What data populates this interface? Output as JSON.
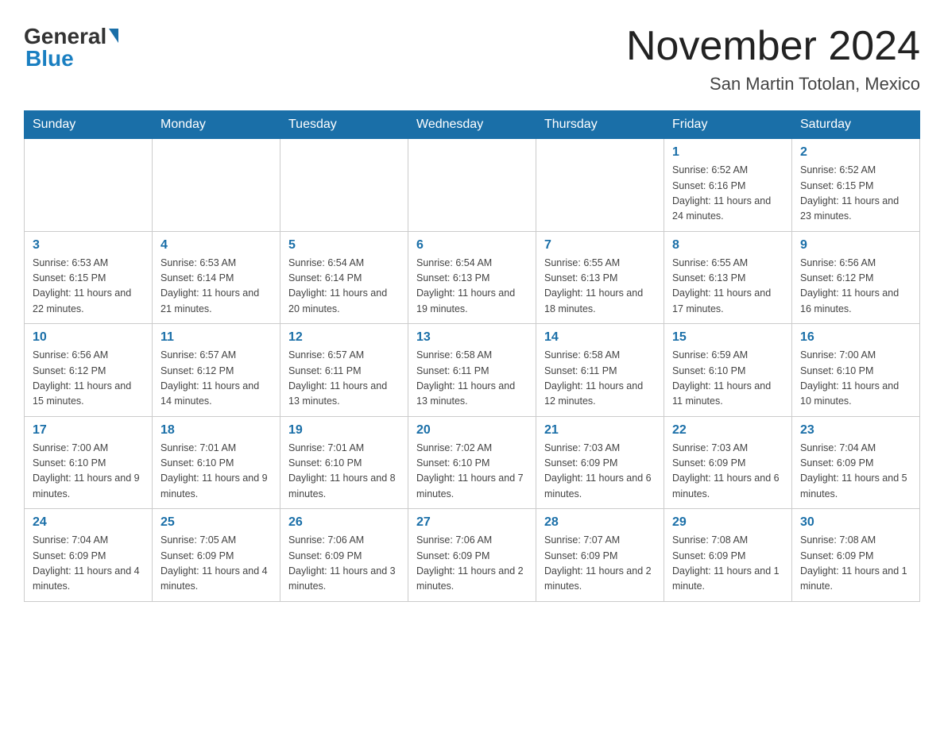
{
  "logo": {
    "general": "General",
    "blue": "Blue"
  },
  "title": "November 2024",
  "subtitle": "San Martin Totolan, Mexico",
  "days_of_week": [
    "Sunday",
    "Monday",
    "Tuesday",
    "Wednesday",
    "Thursday",
    "Friday",
    "Saturday"
  ],
  "weeks": [
    [
      {
        "day": "",
        "sunrise": "",
        "sunset": "",
        "daylight": ""
      },
      {
        "day": "",
        "sunrise": "",
        "sunset": "",
        "daylight": ""
      },
      {
        "day": "",
        "sunrise": "",
        "sunset": "",
        "daylight": ""
      },
      {
        "day": "",
        "sunrise": "",
        "sunset": "",
        "daylight": ""
      },
      {
        "day": "",
        "sunrise": "",
        "sunset": "",
        "daylight": ""
      },
      {
        "day": "1",
        "sunrise": "Sunrise: 6:52 AM",
        "sunset": "Sunset: 6:16 PM",
        "daylight": "Daylight: 11 hours and 24 minutes."
      },
      {
        "day": "2",
        "sunrise": "Sunrise: 6:52 AM",
        "sunset": "Sunset: 6:15 PM",
        "daylight": "Daylight: 11 hours and 23 minutes."
      }
    ],
    [
      {
        "day": "3",
        "sunrise": "Sunrise: 6:53 AM",
        "sunset": "Sunset: 6:15 PM",
        "daylight": "Daylight: 11 hours and 22 minutes."
      },
      {
        "day": "4",
        "sunrise": "Sunrise: 6:53 AM",
        "sunset": "Sunset: 6:14 PM",
        "daylight": "Daylight: 11 hours and 21 minutes."
      },
      {
        "day": "5",
        "sunrise": "Sunrise: 6:54 AM",
        "sunset": "Sunset: 6:14 PM",
        "daylight": "Daylight: 11 hours and 20 minutes."
      },
      {
        "day": "6",
        "sunrise": "Sunrise: 6:54 AM",
        "sunset": "Sunset: 6:13 PM",
        "daylight": "Daylight: 11 hours and 19 minutes."
      },
      {
        "day": "7",
        "sunrise": "Sunrise: 6:55 AM",
        "sunset": "Sunset: 6:13 PM",
        "daylight": "Daylight: 11 hours and 18 minutes."
      },
      {
        "day": "8",
        "sunrise": "Sunrise: 6:55 AM",
        "sunset": "Sunset: 6:13 PM",
        "daylight": "Daylight: 11 hours and 17 minutes."
      },
      {
        "day": "9",
        "sunrise": "Sunrise: 6:56 AM",
        "sunset": "Sunset: 6:12 PM",
        "daylight": "Daylight: 11 hours and 16 minutes."
      }
    ],
    [
      {
        "day": "10",
        "sunrise": "Sunrise: 6:56 AM",
        "sunset": "Sunset: 6:12 PM",
        "daylight": "Daylight: 11 hours and 15 minutes."
      },
      {
        "day": "11",
        "sunrise": "Sunrise: 6:57 AM",
        "sunset": "Sunset: 6:12 PM",
        "daylight": "Daylight: 11 hours and 14 minutes."
      },
      {
        "day": "12",
        "sunrise": "Sunrise: 6:57 AM",
        "sunset": "Sunset: 6:11 PM",
        "daylight": "Daylight: 11 hours and 13 minutes."
      },
      {
        "day": "13",
        "sunrise": "Sunrise: 6:58 AM",
        "sunset": "Sunset: 6:11 PM",
        "daylight": "Daylight: 11 hours and 13 minutes."
      },
      {
        "day": "14",
        "sunrise": "Sunrise: 6:58 AM",
        "sunset": "Sunset: 6:11 PM",
        "daylight": "Daylight: 11 hours and 12 minutes."
      },
      {
        "day": "15",
        "sunrise": "Sunrise: 6:59 AM",
        "sunset": "Sunset: 6:10 PM",
        "daylight": "Daylight: 11 hours and 11 minutes."
      },
      {
        "day": "16",
        "sunrise": "Sunrise: 7:00 AM",
        "sunset": "Sunset: 6:10 PM",
        "daylight": "Daylight: 11 hours and 10 minutes."
      }
    ],
    [
      {
        "day": "17",
        "sunrise": "Sunrise: 7:00 AM",
        "sunset": "Sunset: 6:10 PM",
        "daylight": "Daylight: 11 hours and 9 minutes."
      },
      {
        "day": "18",
        "sunrise": "Sunrise: 7:01 AM",
        "sunset": "Sunset: 6:10 PM",
        "daylight": "Daylight: 11 hours and 9 minutes."
      },
      {
        "day": "19",
        "sunrise": "Sunrise: 7:01 AM",
        "sunset": "Sunset: 6:10 PM",
        "daylight": "Daylight: 11 hours and 8 minutes."
      },
      {
        "day": "20",
        "sunrise": "Sunrise: 7:02 AM",
        "sunset": "Sunset: 6:10 PM",
        "daylight": "Daylight: 11 hours and 7 minutes."
      },
      {
        "day": "21",
        "sunrise": "Sunrise: 7:03 AM",
        "sunset": "Sunset: 6:09 PM",
        "daylight": "Daylight: 11 hours and 6 minutes."
      },
      {
        "day": "22",
        "sunrise": "Sunrise: 7:03 AM",
        "sunset": "Sunset: 6:09 PM",
        "daylight": "Daylight: 11 hours and 6 minutes."
      },
      {
        "day": "23",
        "sunrise": "Sunrise: 7:04 AM",
        "sunset": "Sunset: 6:09 PM",
        "daylight": "Daylight: 11 hours and 5 minutes."
      }
    ],
    [
      {
        "day": "24",
        "sunrise": "Sunrise: 7:04 AM",
        "sunset": "Sunset: 6:09 PM",
        "daylight": "Daylight: 11 hours and 4 minutes."
      },
      {
        "day": "25",
        "sunrise": "Sunrise: 7:05 AM",
        "sunset": "Sunset: 6:09 PM",
        "daylight": "Daylight: 11 hours and 4 minutes."
      },
      {
        "day": "26",
        "sunrise": "Sunrise: 7:06 AM",
        "sunset": "Sunset: 6:09 PM",
        "daylight": "Daylight: 11 hours and 3 minutes."
      },
      {
        "day": "27",
        "sunrise": "Sunrise: 7:06 AM",
        "sunset": "Sunset: 6:09 PM",
        "daylight": "Daylight: 11 hours and 2 minutes."
      },
      {
        "day": "28",
        "sunrise": "Sunrise: 7:07 AM",
        "sunset": "Sunset: 6:09 PM",
        "daylight": "Daylight: 11 hours and 2 minutes."
      },
      {
        "day": "29",
        "sunrise": "Sunrise: 7:08 AM",
        "sunset": "Sunset: 6:09 PM",
        "daylight": "Daylight: 11 hours and 1 minute."
      },
      {
        "day": "30",
        "sunrise": "Sunrise: 7:08 AM",
        "sunset": "Sunset: 6:09 PM",
        "daylight": "Daylight: 11 hours and 1 minute."
      }
    ]
  ]
}
